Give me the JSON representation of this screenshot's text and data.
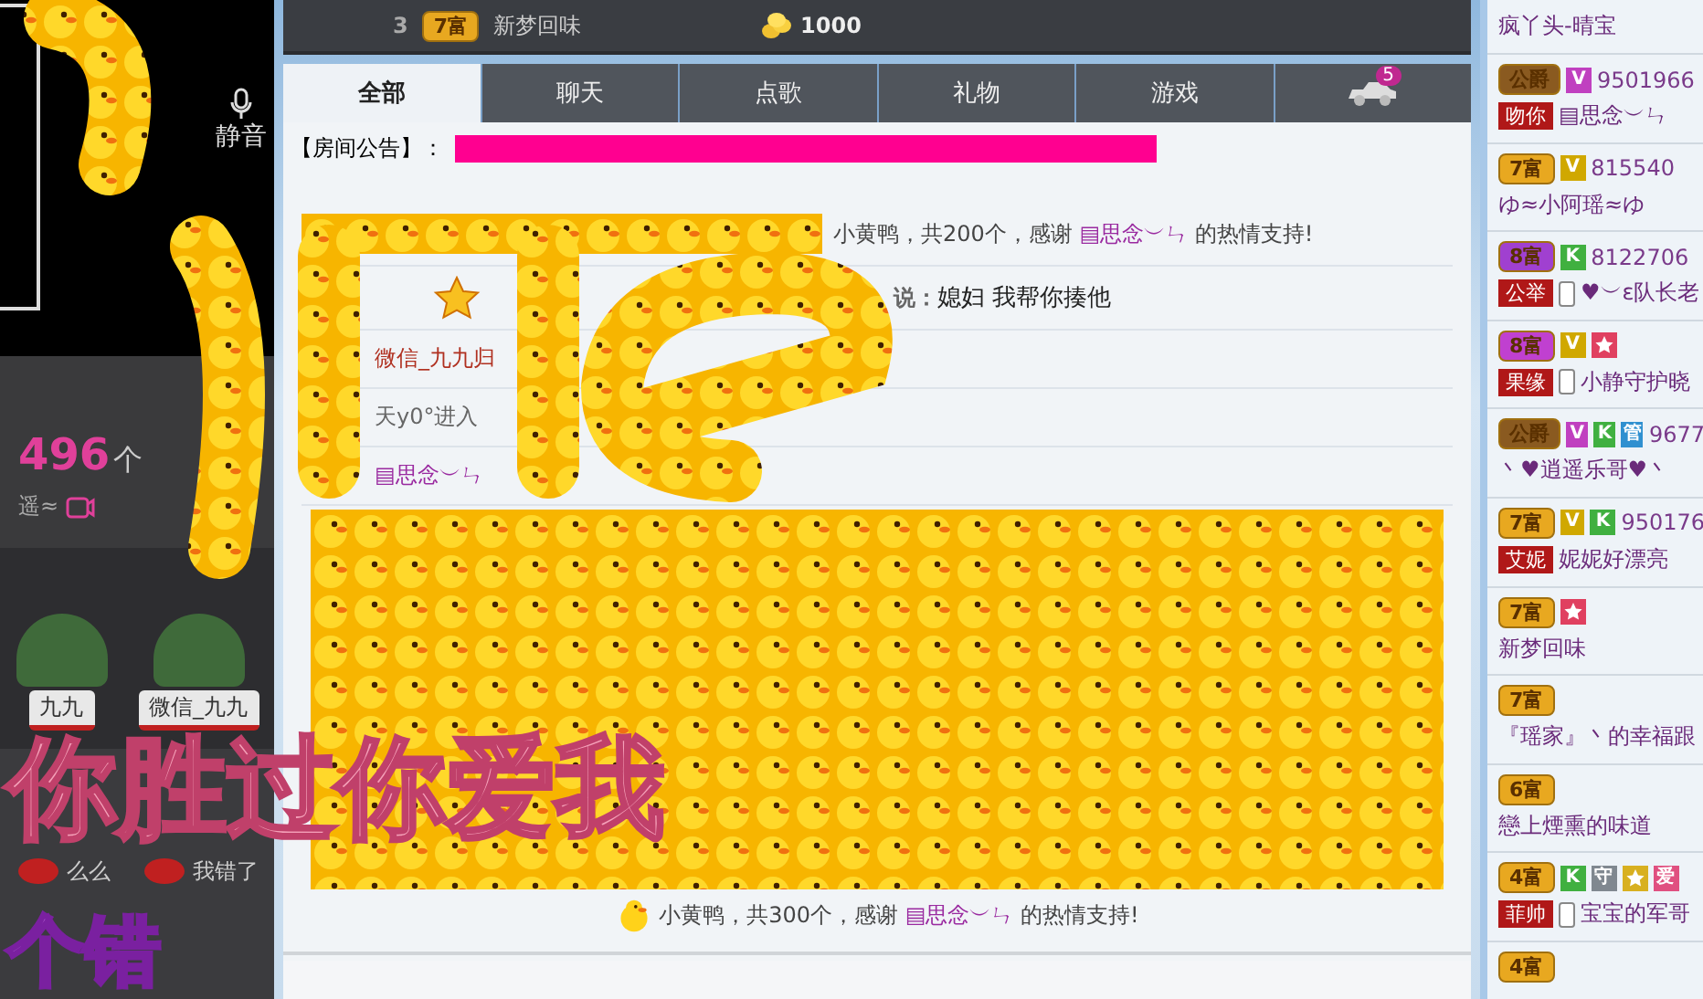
{
  "leaderboard": {
    "rank": "3",
    "badge": "7富",
    "name": "新梦回味",
    "coins": "1000"
  },
  "tabs": [
    {
      "label": "全部",
      "selected": true,
      "kind": "text"
    },
    {
      "label": "聊天",
      "selected": false,
      "kind": "text"
    },
    {
      "label": "点歌",
      "selected": false,
      "kind": "text"
    },
    {
      "label": "礼物",
      "selected": false,
      "kind": "text"
    },
    {
      "label": "游戏",
      "selected": false,
      "kind": "text"
    },
    {
      "kind": "car",
      "count": "5",
      "selected": false
    }
  ],
  "announcement": {
    "label": "【房间公告】："
  },
  "messages": [
    {
      "kind": "gift_strip",
      "text": "小黄鸭，共200个，感谢 **▤思念︶ㄣ** 的热情支持!"
    },
    {
      "kind": "chat",
      "verb": "说：",
      "text": "媳妇 我帮你揍他"
    },
    {
      "kind": "notice",
      "text": "微信_九九归",
      "color": "#b03020"
    },
    {
      "kind": "notice",
      "text": "天y0°进入",
      "color": "#666666"
    },
    {
      "kind": "notice",
      "text": "▤思念︶ㄣ",
      "color": "#9a2aa0"
    },
    {
      "kind": "gift_grid",
      "text": "小黄鸭，共300个，感谢 **▤思念︶ㄣ** 的热情支持!"
    }
  ],
  "stream": {
    "mute_label": "静音",
    "count": "496",
    "count_unit": "个",
    "host_name": "遥≈",
    "guards": [
      {
        "name": "九九"
      },
      {
        "name": "微信_九九"
      }
    ],
    "gifts": [
      {
        "label": "么么"
      },
      {
        "label": "我错了"
      }
    ]
  },
  "overlay": {
    "caption": "你胜过你爱我",
    "caption_2": "个错"
  },
  "users": [
    {
      "name": "疯丫头-晴宝"
    },
    {
      "badges": [
        {
          "kind": "rank",
          "text": "公爵",
          "color": "#8a5a20"
        },
        {
          "kind": "letter",
          "text": "V",
          "color": "#c040c0"
        }
      ],
      "id": "9501966",
      "tag": "吻你",
      "phone": false,
      "name": "▤思念︶ㄣ"
    },
    {
      "badges": [
        {
          "kind": "rank",
          "text": "7富",
          "color": "#e8a820"
        },
        {
          "kind": "letter",
          "text": "V",
          "color": "#d0a800"
        }
      ],
      "id": "815540",
      "name": "ゆ≈小阿瑶≈ゆ"
    },
    {
      "badges": [
        {
          "kind": "rank",
          "text": "8富",
          "color": "#a040d0"
        },
        {
          "kind": "letter",
          "text": "K",
          "color": "#40b040"
        }
      ],
      "id": "8122706",
      "tag": "公举",
      "phone": true,
      "name": "♥︶ε队长老"
    },
    {
      "badges": [
        {
          "kind": "rank",
          "text": "8富",
          "color": "#c040d0"
        },
        {
          "kind": "letter",
          "text": "V",
          "color": "#d0a800"
        },
        {
          "kind": "star",
          "color": "#e04060"
        }
      ],
      "tag": "果缘",
      "phone": true,
      "name": "小静守护晓"
    },
    {
      "badges": [
        {
          "kind": "rank",
          "text": "公爵",
          "color": "#8a5a20"
        },
        {
          "kind": "letter",
          "text": "V",
          "color": "#c040c0"
        },
        {
          "kind": "letter",
          "text": "K",
          "color": "#40b040"
        },
        {
          "kind": "letter",
          "text": "管",
          "color": "#3090d0"
        }
      ],
      "id": "9677",
      "name": "丶♥逍遥乐哥♥丶"
    },
    {
      "badges": [
        {
          "kind": "rank",
          "text": "7富",
          "color": "#e8a820"
        },
        {
          "kind": "letter",
          "text": "V",
          "color": "#d0a800"
        },
        {
          "kind": "letter",
          "text": "K",
          "color": "#40b040"
        }
      ],
      "id": "950176",
      "tag": "艾妮",
      "phone": false,
      "name": "妮妮好漂亮"
    },
    {
      "badges": [
        {
          "kind": "rank",
          "text": "7富",
          "color": "#e8a820"
        },
        {
          "kind": "star",
          "color": "#e04060"
        }
      ],
      "name": "新梦回味"
    },
    {
      "badges": [
        {
          "kind": "rank",
          "text": "7富",
          "color": "#e8a820"
        }
      ],
      "name": "『瑶家』丶的幸福跟"
    },
    {
      "badges": [
        {
          "kind": "rank",
          "text": "6富",
          "color": "#e8a820"
        }
      ],
      "name": "戀上煙熏的味道"
    },
    {
      "badges": [
        {
          "kind": "rank",
          "text": "4富",
          "color": "#e8a820"
        },
        {
          "kind": "letter",
          "text": "K",
          "color": "#40b040"
        },
        {
          "kind": "letter",
          "text": "守",
          "color": "#808890"
        },
        {
          "kind": "star",
          "color": "#d8b020"
        },
        {
          "kind": "letter",
          "text": "爱",
          "color": "#e05080"
        }
      ],
      "tag": "菲帅",
      "phone": true,
      "name": "宝宝的军哥"
    },
    {
      "badges": [
        {
          "kind": "rank",
          "text": "4富",
          "color": "#e8a820"
        }
      ]
    }
  ]
}
